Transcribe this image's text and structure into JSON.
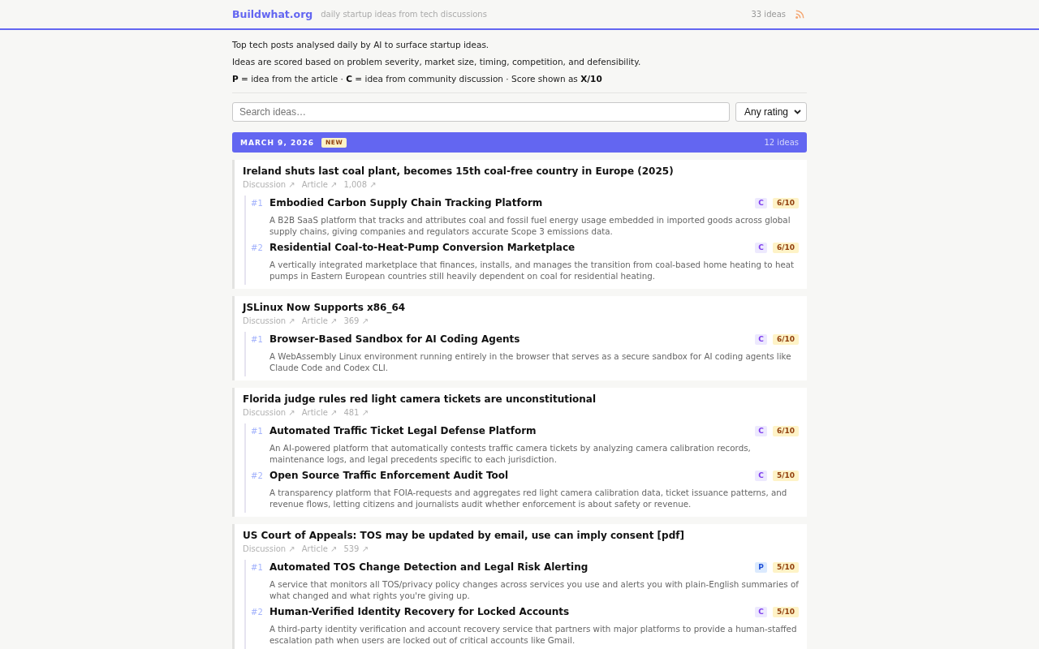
{
  "header": {
    "logo": "Buildwhat.org",
    "tagline": "daily startup ideas from tech discussions",
    "count": "33 ideas"
  },
  "intro": [
    "Top tech posts analysed daily by AI to surface startup ideas.",
    "Ideas are scored based on problem severity, market size, timing, competition, and defensibility.",
    "**P** = idea from the article · **C** = idea from community discussion · Score shown as **X/10**"
  ],
  "filters": {
    "search": {
      "placeholder": "Search ideas…"
    },
    "rating": {
      "value": "Any rating"
    }
  },
  "days": [
    {
      "date": "MARCH 9, 2026",
      "badge": "NEW",
      "count": "12 ideas",
      "posts": [
        {
          "title": "Ireland shuts last coal plant, becomes 15th coal-free country in Europe (2025)",
          "links": [
            "Discussion ↗",
            "Article ↗",
            "1,008 ↗"
          ],
          "ideas": [
            {
              "number": "#1",
              "title": "Embodied Carbon Supply Chain Tracking Platform",
              "source": {
                "label": "C",
                "kind": "community"
              },
              "score": "6/10",
              "description": "A B2B SaaS platform that tracks and attributes coal and fossil fuel energy usage embedded in imported goods across global supply chains, giving companies and regulators accurate Scope 3 emissions data."
            },
            {
              "number": "#2",
              "title": "Residential Coal-to-Heat-Pump Conversion Marketplace",
              "source": {
                "label": "C",
                "kind": "community"
              },
              "score": "6/10",
              "description": "A vertically integrated marketplace that finances, installs, and manages the transition from coal-based home heating to heat pumps in Eastern European countries still heavily dependent on coal for residential heating."
            }
          ]
        },
        {
          "title": "JSLinux Now Supports x86_64",
          "links": [
            "Discussion ↗",
            "Article ↗",
            "369 ↗"
          ],
          "ideas": [
            {
              "number": "#1",
              "title": "Browser-Based Sandbox for AI Coding Agents",
              "source": {
                "label": "C",
                "kind": "community"
              },
              "score": "6/10",
              "description": "A WebAssembly Linux environment running entirely in the browser that serves as a secure sandbox for AI coding agents like Claude Code and Codex CLI."
            }
          ]
        },
        {
          "title": "Florida judge rules red light camera tickets are unconstitutional",
          "links": [
            "Discussion ↗",
            "Article ↗",
            "481 ↗"
          ],
          "ideas": [
            {
              "number": "#1",
              "title": "Automated Traffic Ticket Legal Defense Platform",
              "source": {
                "label": "C",
                "kind": "community"
              },
              "score": "6/10",
              "description": "An AI-powered platform that automatically contests traffic camera tickets by analyzing camera calibration records, maintenance logs, and legal precedents specific to each jurisdiction."
            },
            {
              "number": "#2",
              "title": "Open Source Traffic Enforcement Audit Tool",
              "source": {
                "label": "C",
                "kind": "community"
              },
              "score": "5/10",
              "description": "A transparency platform that FOIA-requests and aggregates red light camera calibration data, ticket issuance patterns, and revenue flows, letting citizens and journalists audit whether enforcement is about safety or revenue."
            }
          ]
        },
        {
          "title": "US Court of Appeals: TOS may be updated by email, use can imply consent [pdf]",
          "links": [
            "Discussion ↗",
            "Article ↗",
            "539 ↗"
          ],
          "ideas": [
            {
              "number": "#1",
              "title": "Automated TOS Change Detection and Legal Risk Alerting",
              "source": {
                "label": "P",
                "kind": "article"
              },
              "score": "5/10",
              "description": "A service that monitors all TOS/privacy policy changes across services you use and alerts you with plain-English summaries of what changed and what rights you're giving up."
            },
            {
              "number": "#2",
              "title": "Human-Verified Identity Recovery for Locked Accounts",
              "source": {
                "label": "C",
                "kind": "community"
              },
              "score": "5/10",
              "description": "A third-party identity verification and account recovery service that partners with major platforms to provide a human-staffed escalation path when users are locked out of critical accounts like Gmail."
            }
          ]
        }
      ]
    }
  ]
}
